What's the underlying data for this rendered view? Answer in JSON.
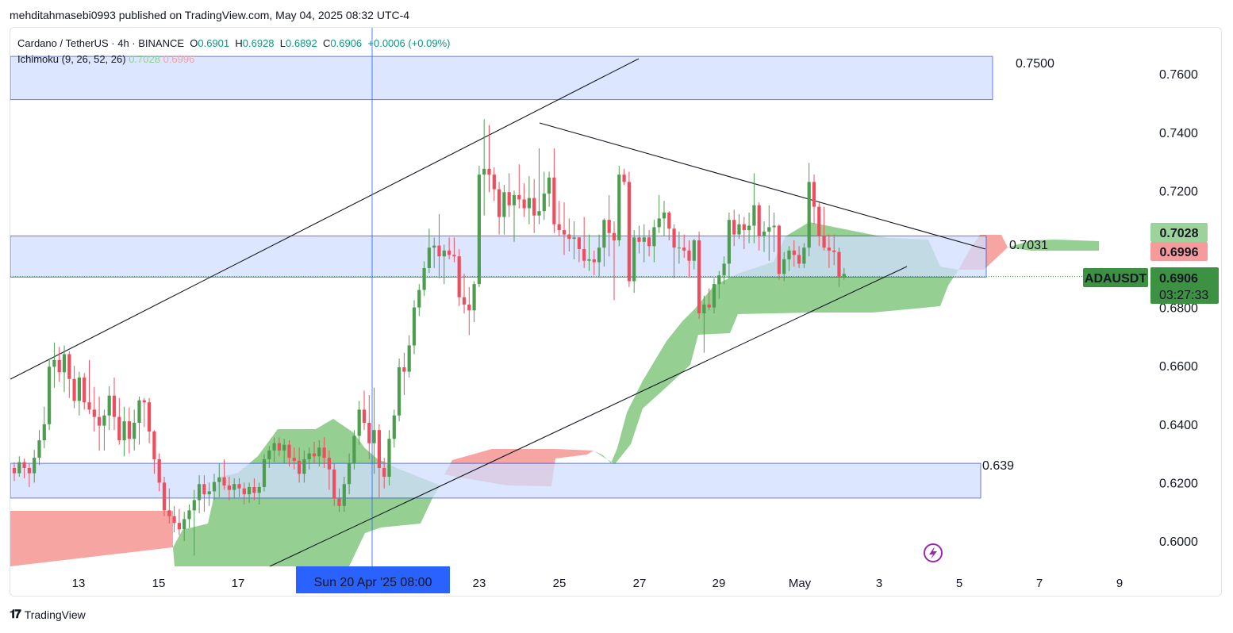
{
  "header": {
    "publisher_line": "mehditahmasebi0993 published on TradingView.com, May 04, 2025 08:32 UTC-4"
  },
  "legend": {
    "symbol_line_prefix": "Cardano / TetherUS · 4h · BINANCE",
    "o_label": "O",
    "o_value": "0.6901",
    "h_label": "H",
    "h_value": "0.6928",
    "l_label": "L",
    "l_value": "0.6892",
    "c_label": "C",
    "c_value": "0.6906",
    "change": "+0.0006 (+0.09%)",
    "ichimoku_label": "Ichimoku (9, 26, 52, 26)",
    "ichimoku_a": "0.7028",
    "ichimoku_b": "0.6996"
  },
  "colors": {
    "up": "#4d9c50",
    "down": "#ef4d5e",
    "cloud_bull": "#8fcd8c",
    "cloud_bear": "#f5a09e",
    "zone": "#d2deff",
    "zone_border": "#2f50d6",
    "price_tag": "#3d9142",
    "time_tag": "#2962ff"
  },
  "footer": {
    "brand": "TradingView"
  },
  "chart_data": {
    "type": "candlestick",
    "symbol": "ADAUSDT",
    "timeframe": "4h",
    "y_axis": {
      "ticks": [
        "0.7600",
        "0.7400",
        "0.7200",
        "0.6800",
        "0.6600",
        "0.6400",
        "0.6200",
        "0.6000"
      ],
      "range": [
        0.5912,
        0.7733
      ]
    },
    "x_axis": {
      "ticks": [
        "13",
        "15",
        "17",
        "23",
        "25",
        "27",
        "29",
        "May",
        "3",
        "5",
        "7",
        "9"
      ],
      "hovered_time": "Sun 20 Apr '25   08:00"
    },
    "price_tags": [
      {
        "label": "0.7028",
        "kind": "ichimoku-a"
      },
      {
        "label": "0.6996",
        "kind": "ichimoku-b"
      },
      {
        "label": "0.6906",
        "kind": "last"
      },
      {
        "label": "03:27:33",
        "kind": "countdown"
      }
    ],
    "symbol_tag": "ADAUSDT",
    "zones": [
      {
        "top": 0.766,
        "bottom": 0.7512,
        "label": "0.7500"
      },
      {
        "top": 0.7045,
        "bottom": 0.6904,
        "label": "0.7031"
      },
      {
        "top": 0.6266,
        "bottom": 0.6147,
        "label": "0.639"
      }
    ],
    "candles": [
      [
        0.625,
        0.627,
        0.6205,
        0.6232
      ],
      [
        0.6232,
        0.629,
        0.622,
        0.627
      ],
      [
        0.627,
        0.6282,
        0.6215,
        0.625
      ],
      [
        0.625,
        0.6268,
        0.6185,
        0.6232
      ],
      [
        0.6232,
        0.6312,
        0.62,
        0.6285
      ],
      [
        0.6285,
        0.638,
        0.626,
        0.6345
      ],
      [
        0.6345,
        0.646,
        0.6318,
        0.64
      ],
      [
        0.64,
        0.6625,
        0.638,
        0.6597
      ],
      [
        0.6597,
        0.668,
        0.6525,
        0.662
      ],
      [
        0.662,
        0.6665,
        0.6545,
        0.6578
      ],
      [
        0.6578,
        0.667,
        0.651,
        0.664
      ],
      [
        0.664,
        0.665,
        0.649,
        0.6555
      ],
      [
        0.6555,
        0.66,
        0.6455,
        0.648
      ],
      [
        0.648,
        0.658,
        0.643,
        0.656
      ],
      [
        0.656,
        0.6575,
        0.645,
        0.6475
      ],
      [
        0.6475,
        0.662,
        0.6435,
        0.645
      ],
      [
        0.645,
        0.6528,
        0.6375,
        0.6425
      ],
      [
        0.6425,
        0.6495,
        0.631,
        0.6395
      ],
      [
        0.6395,
        0.645,
        0.631,
        0.643
      ],
      [
        0.643,
        0.653,
        0.638,
        0.6498
      ],
      [
        0.6498,
        0.656,
        0.638,
        0.6425
      ],
      [
        0.6425,
        0.649,
        0.633,
        0.6345
      ],
      [
        0.6345,
        0.646,
        0.629,
        0.641
      ],
      [
        0.641,
        0.6458,
        0.63,
        0.635
      ],
      [
        0.635,
        0.645,
        0.631,
        0.6405
      ],
      [
        0.6405,
        0.6495,
        0.633,
        0.6482
      ],
      [
        0.6482,
        0.649,
        0.639,
        0.6475
      ],
      [
        0.6475,
        0.649,
        0.6335,
        0.6375
      ],
      [
        0.6375,
        0.638,
        0.623,
        0.628
      ],
      [
        0.628,
        0.63,
        0.617,
        0.62
      ],
      [
        0.62,
        0.622,
        0.6085,
        0.6105
      ],
      [
        0.6105,
        0.618,
        0.606,
        0.6085
      ],
      [
        0.6085,
        0.612,
        0.603,
        0.6062
      ],
      [
        0.6062,
        0.611,
        0.602,
        0.604
      ],
      [
        0.604,
        0.61,
        0.6,
        0.6075
      ],
      [
        0.6075,
        0.6125,
        0.6045,
        0.6105
      ],
      [
        0.6105,
        0.6175,
        0.595,
        0.614
      ],
      [
        0.614,
        0.6225,
        0.6095,
        0.6195
      ],
      [
        0.6195,
        0.6225,
        0.61,
        0.616
      ],
      [
        0.616,
        0.62,
        0.612,
        0.617
      ],
      [
        0.617,
        0.623,
        0.614,
        0.6202
      ],
      [
        0.6202,
        0.6265,
        0.615,
        0.6218
      ],
      [
        0.6218,
        0.628,
        0.6175,
        0.619
      ],
      [
        0.619,
        0.622,
        0.614,
        0.6175
      ],
      [
        0.6175,
        0.6215,
        0.6145,
        0.6195
      ],
      [
        0.6195,
        0.6215,
        0.615,
        0.618
      ],
      [
        0.618,
        0.62,
        0.6125,
        0.616
      ],
      [
        0.616,
        0.62,
        0.613,
        0.6185
      ],
      [
        0.6185,
        0.6215,
        0.614,
        0.6165
      ],
      [
        0.6165,
        0.62,
        0.6125,
        0.6185
      ],
      [
        0.6185,
        0.6298,
        0.617,
        0.628
      ],
      [
        0.628,
        0.6325,
        0.625,
        0.631
      ],
      [
        0.631,
        0.6355,
        0.627,
        0.6335
      ],
      [
        0.6335,
        0.6355,
        0.629,
        0.631
      ],
      [
        0.631,
        0.635,
        0.6265,
        0.633
      ],
      [
        0.633,
        0.6345,
        0.6255,
        0.6285
      ],
      [
        0.6285,
        0.632,
        0.6245,
        0.6275
      ],
      [
        0.6275,
        0.632,
        0.62,
        0.623
      ],
      [
        0.623,
        0.631,
        0.62,
        0.628
      ],
      [
        0.628,
        0.632,
        0.6245,
        0.63
      ],
      [
        0.63,
        0.634,
        0.6265,
        0.629
      ],
      [
        0.629,
        0.6345,
        0.6255,
        0.632
      ],
      [
        0.632,
        0.6355,
        0.625,
        0.6285
      ],
      [
        0.6285,
        0.631,
        0.6175,
        0.6245
      ],
      [
        0.6245,
        0.6265,
        0.612,
        0.6145
      ],
      [
        0.6145,
        0.618,
        0.61,
        0.612
      ],
      [
        0.612,
        0.622,
        0.61,
        0.6195
      ],
      [
        0.6195,
        0.63,
        0.616,
        0.6265
      ],
      [
        0.6265,
        0.638,
        0.6245,
        0.636
      ],
      [
        0.636,
        0.648,
        0.633,
        0.645
      ],
      [
        0.645,
        0.6515,
        0.638,
        0.6405
      ],
      [
        0.6405,
        0.65,
        0.628,
        0.6335
      ],
      [
        0.6335,
        0.6525,
        0.623,
        0.638
      ],
      [
        0.638,
        0.64,
        0.615,
        0.625
      ],
      [
        0.625,
        0.6285,
        0.618,
        0.622
      ],
      [
        0.622,
        0.638,
        0.619,
        0.635
      ],
      [
        0.635,
        0.645,
        0.632,
        0.643
      ],
      [
        0.643,
        0.6625,
        0.641,
        0.6595
      ],
      [
        0.6595,
        0.6645,
        0.65,
        0.658
      ],
      [
        0.658,
        0.6705,
        0.656,
        0.667
      ],
      [
        0.667,
        0.6825,
        0.664,
        0.68
      ],
      [
        0.68,
        0.688,
        0.677,
        0.686
      ],
      [
        0.686,
        0.6958,
        0.684,
        0.6935
      ],
      [
        0.6935,
        0.707,
        0.6918,
        0.7005
      ],
      [
        0.7005,
        0.704,
        0.6935,
        0.7012
      ],
      [
        0.7012,
        0.712,
        0.69,
        0.6975
      ],
      [
        0.6975,
        0.7015,
        0.688,
        0.6995
      ],
      [
        0.6995,
        0.704,
        0.6965,
        0.698
      ],
      [
        0.698,
        0.704,
        0.6955,
        0.6975
      ],
      [
        0.6975,
        0.7,
        0.6805,
        0.6835
      ],
      [
        0.6835,
        0.6915,
        0.678,
        0.681
      ],
      [
        0.681,
        0.687,
        0.6705,
        0.679
      ],
      [
        0.679,
        0.689,
        0.675,
        0.688
      ],
      [
        0.688,
        0.7285,
        0.687,
        0.7255
      ],
      [
        0.7255,
        0.7445,
        0.7115,
        0.7275
      ],
      [
        0.7275,
        0.7425,
        0.7195,
        0.7255
      ],
      [
        0.7255,
        0.728,
        0.7165,
        0.7205
      ],
      [
        0.7205,
        0.723,
        0.705,
        0.711
      ],
      [
        0.711,
        0.722,
        0.705,
        0.7195
      ],
      [
        0.7195,
        0.726,
        0.711,
        0.715
      ],
      [
        0.715,
        0.72,
        0.7025,
        0.7185
      ],
      [
        0.7185,
        0.729,
        0.714,
        0.717
      ],
      [
        0.717,
        0.7225,
        0.711,
        0.714
      ],
      [
        0.714,
        0.725,
        0.7085,
        0.7175
      ],
      [
        0.7175,
        0.724,
        0.7055,
        0.7115
      ],
      [
        0.7115,
        0.7345,
        0.7085,
        0.713
      ],
      [
        0.713,
        0.7265,
        0.71,
        0.719
      ],
      [
        0.719,
        0.7265,
        0.7145,
        0.7245
      ],
      [
        0.7245,
        0.7345,
        0.7055,
        0.7085
      ],
      [
        0.7085,
        0.7165,
        0.7045,
        0.7065
      ],
      [
        0.7065,
        0.716,
        0.698,
        0.705
      ],
      [
        0.705,
        0.7105,
        0.6992,
        0.7035
      ],
      [
        0.7035,
        0.7095,
        0.6965,
        0.704
      ],
      [
        0.704,
        0.704,
        0.6955,
        0.7
      ],
      [
        0.7,
        0.711,
        0.6935,
        0.696
      ],
      [
        0.696,
        0.705,
        0.6925,
        0.6965
      ],
      [
        0.6965,
        0.6995,
        0.691,
        0.6955
      ],
      [
        0.6955,
        0.705,
        0.6905,
        0.7005
      ],
      [
        0.7005,
        0.7105,
        0.694,
        0.71
      ],
      [
        0.71,
        0.7185,
        0.6975,
        0.7055
      ],
      [
        0.7055,
        0.7095,
        0.6825,
        0.703
      ],
      [
        0.703,
        0.7285,
        0.701,
        0.7255
      ],
      [
        0.7255,
        0.7275,
        0.722,
        0.723
      ],
      [
        0.723,
        0.7265,
        0.687,
        0.689
      ],
      [
        0.689,
        0.7065,
        0.685,
        0.704
      ],
      [
        0.704,
        0.708,
        0.6985,
        0.7025
      ],
      [
        0.7025,
        0.7085,
        0.6955,
        0.704
      ],
      [
        0.704,
        0.7065,
        0.6975,
        0.701
      ],
      [
        0.701,
        0.71,
        0.6955,
        0.7075
      ],
      [
        0.7075,
        0.7185,
        0.7055,
        0.7105
      ],
      [
        0.7105,
        0.7165,
        0.7045,
        0.7125
      ],
      [
        0.7125,
        0.713,
        0.703,
        0.707
      ],
      [
        0.707,
        0.7085,
        0.69,
        0.7005
      ],
      [
        0.7005,
        0.706,
        0.695,
        0.7005
      ],
      [
        0.7005,
        0.705,
        0.697,
        0.6995
      ],
      [
        0.6995,
        0.703,
        0.6905,
        0.696
      ],
      [
        0.696,
        0.7035,
        0.693,
        0.703
      ],
      [
        0.703,
        0.706,
        0.676,
        0.678
      ],
      [
        0.678,
        0.684,
        0.6645,
        0.681
      ],
      [
        0.681,
        0.6865,
        0.679,
        0.68
      ],
      [
        0.68,
        0.69,
        0.678,
        0.688
      ],
      [
        0.688,
        0.6925,
        0.683,
        0.691
      ],
      [
        0.691,
        0.6975,
        0.688,
        0.695
      ],
      [
        0.695,
        0.7125,
        0.69,
        0.71
      ],
      [
        0.71,
        0.7135,
        0.701,
        0.705
      ],
      [
        0.705,
        0.712,
        0.7035,
        0.7085
      ],
      [
        0.7085,
        0.711,
        0.7,
        0.7065
      ],
      [
        0.7065,
        0.7125,
        0.702,
        0.708
      ],
      [
        0.708,
        0.726,
        0.702,
        0.715
      ],
      [
        0.715,
        0.716,
        0.6995,
        0.7045
      ],
      [
        0.7045,
        0.7095,
        0.699,
        0.706
      ],
      [
        0.706,
        0.715,
        0.696,
        0.7075
      ],
      [
        0.7075,
        0.7125,
        0.699,
        0.708
      ],
      [
        0.708,
        0.7085,
        0.6895,
        0.6915
      ],
      [
        0.6915,
        0.699,
        0.689,
        0.6965
      ],
      [
        0.6965,
        0.701,
        0.6925,
        0.6995
      ],
      [
        0.6995,
        0.703,
        0.694,
        0.698
      ],
      [
        0.698,
        0.701,
        0.6935,
        0.695
      ],
      [
        0.695,
        0.702,
        0.6935,
        0.7005
      ],
      [
        0.7005,
        0.7295,
        0.6975,
        0.723
      ],
      [
        0.723,
        0.7255,
        0.7085,
        0.7145
      ],
      [
        0.7145,
        0.716,
        0.701,
        0.7045
      ],
      [
        0.7045,
        0.7145,
        0.6995,
        0.7005
      ],
      [
        0.7005,
        0.705,
        0.6935,
        0.6995
      ],
      [
        0.6995,
        0.705,
        0.6945,
        0.699
      ],
      [
        0.699,
        0.7005,
        0.687,
        0.6905
      ],
      [
        0.6905,
        0.6935,
        0.6895,
        0.6915
      ]
    ],
    "ichimoku_cloud": [
      {
        "kind": "bear",
        "top": [
          [
            0,
            0.61
          ],
          [
            56,
            0.61
          ],
          [
            56,
            0.5912
          ]
        ],
        "note": "left bearish cloud"
      }
    ]
  }
}
